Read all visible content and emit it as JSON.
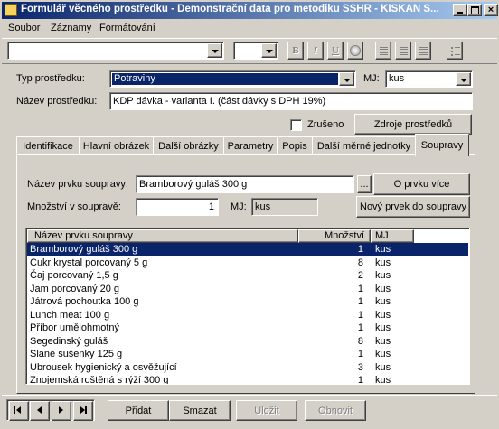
{
  "window": {
    "title": "Formulář věcného prostředku - Demonstrační data pro metodiku SSHR - KISKAN S..."
  },
  "menu": [
    "Soubor",
    "Záznamy",
    "Formátování"
  ],
  "form": {
    "typ_label": "Typ prostředku:",
    "typ_value": "Potraviny",
    "mj_label": "MJ:",
    "mj_value": "kus",
    "nazev_label": "Název prostředku:",
    "nazev_value": "KDP dávka - varianta I. (část dávky s DPH 19%)",
    "zruseno_label": "Zrušeno",
    "zdroje_button": "Zdroje prostředků"
  },
  "tabs": [
    "Identifikace",
    "Hlavní obrázek",
    "Další obrázky",
    "Parametry",
    "Popis",
    "Další měrné jednotky",
    "Soupravy"
  ],
  "active_tab": "Soupravy",
  "soupravy": {
    "nazev_prvku_label": "Název prvku soupravy:",
    "nazev_prvku_value": "Bramborový guláš 300 g",
    "ellipsis": "...",
    "o_prvku_button": "O prvku více",
    "mnozstvi_label": "Množství v soupravě:",
    "mnozstvi_value": "1",
    "mj_label": "MJ:",
    "mj_value": "kus",
    "novy_prvek_button": "Nový prvek do soupravy",
    "table": {
      "headers": [
        "Název prvku soupravy",
        "Množství",
        "MJ"
      ],
      "rows": [
        [
          "Bramborový guláš 300 g",
          "1",
          "kus"
        ],
        [
          "Cukr krystal porcovaný 5 g",
          "8",
          "kus"
        ],
        [
          "Čaj porcovaný 1,5 g",
          "2",
          "kus"
        ],
        [
          "Jam porcovaný 20 g",
          "1",
          "kus"
        ],
        [
          "Játrová pochoutka 100 g",
          "1",
          "kus"
        ],
        [
          "Lunch meat 100 g",
          "1",
          "kus"
        ],
        [
          "Příbor umělohmotný",
          "1",
          "kus"
        ],
        [
          "Segedinský guláš",
          "8",
          "kus"
        ],
        [
          "Slané sušenky 125 g",
          "1",
          "kus"
        ],
        [
          "Ubrousek hygienický a osvěžující",
          "3",
          "kus"
        ],
        [
          "Znojemská roštěná s rýží 300 g",
          "1",
          "kus"
        ]
      ],
      "selected_row": 0
    }
  },
  "bottom": {
    "pridat": "Přidat",
    "smazat": "Smazat",
    "ulozit": "Uložit",
    "obnovit": "Obnovit"
  },
  "toolbar_icons": [
    "bold-icon",
    "italic-icon",
    "underline-icon",
    "color-icon",
    "align-left-icon",
    "align-center-icon",
    "align-right-icon",
    "list-icon"
  ]
}
